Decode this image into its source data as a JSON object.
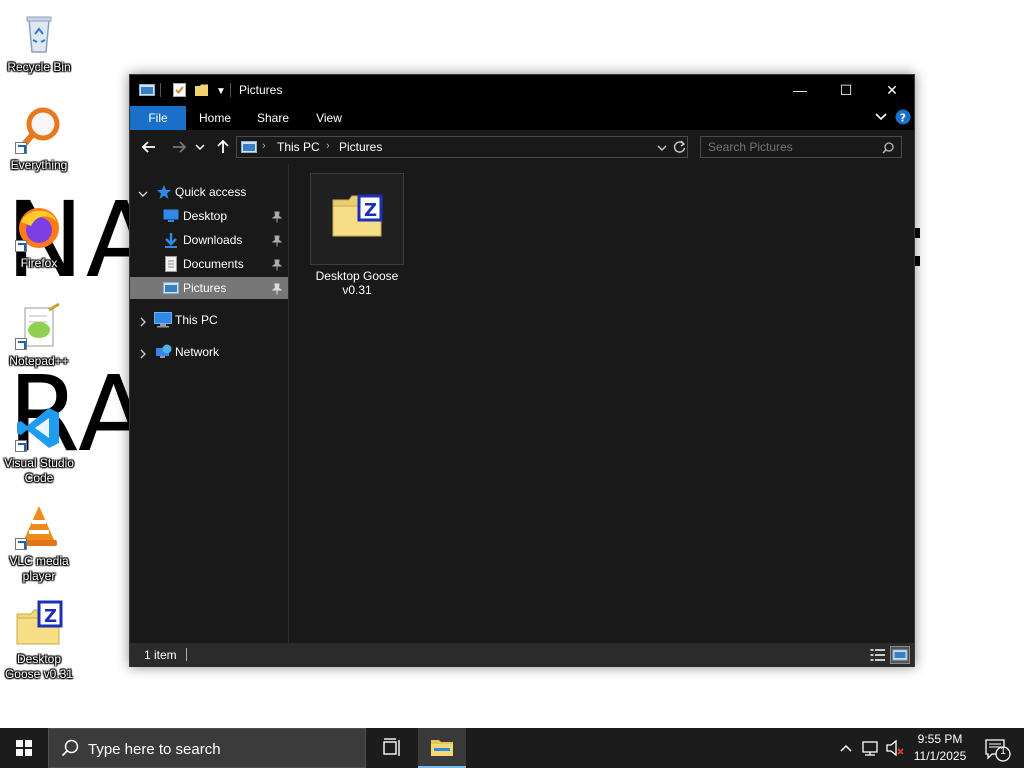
{
  "desktop": {
    "bg_text_1": "NA",
    "bg_text_2": "RA",
    "icons": [
      {
        "label": "Recycle Bin"
      },
      {
        "label": "Everything"
      },
      {
        "label": "Firefox"
      },
      {
        "label": "Notepad++"
      },
      {
        "label": "Visual Studio Code"
      },
      {
        "label": "VLC media player"
      },
      {
        "label": "Desktop Goose v0.31"
      }
    ]
  },
  "window": {
    "title": "Pictures",
    "controls": {
      "minimize": "—",
      "maximize": "☐",
      "close": "✕"
    },
    "ribbon_tabs": [
      "File",
      "Home",
      "Share",
      "View"
    ],
    "address": {
      "crumbs": [
        "This PC",
        "Pictures"
      ]
    },
    "search": {
      "placeholder": "Search Pictures"
    },
    "nav": {
      "quick_access": "Quick access",
      "pinned": [
        "Desktop",
        "Downloads",
        "Documents",
        "Pictures"
      ],
      "this_pc": "This PC",
      "network": "Network"
    },
    "content": {
      "items": [
        {
          "name": "Desktop Goose v0.31"
        }
      ]
    },
    "status": {
      "count": "1 item"
    }
  },
  "taskbar": {
    "search_placeholder": "Type here to search",
    "clock": {
      "time": "9:55 PM",
      "date": "11/1/2025"
    },
    "notification_count": "1"
  },
  "colors": {
    "accent": "#1a70c8",
    "window_bg": "#191919",
    "taskbar_bg": "#1c1c1c",
    "selection": "#777777"
  },
  "icons": [
    "recycle-bin-icon",
    "everything-icon",
    "firefox-icon",
    "notepadpp-icon",
    "vscode-icon",
    "vlc-icon",
    "goose-folder-icon",
    "folder-icon",
    "this-pc-icon",
    "network-icon",
    "star-icon",
    "pin-icon",
    "windows-icon",
    "search-icon",
    "task-view-icon",
    "file-explorer-icon",
    "chevron-up-icon",
    "network-tray-icon",
    "volume-muted-icon",
    "notification-icon"
  ]
}
